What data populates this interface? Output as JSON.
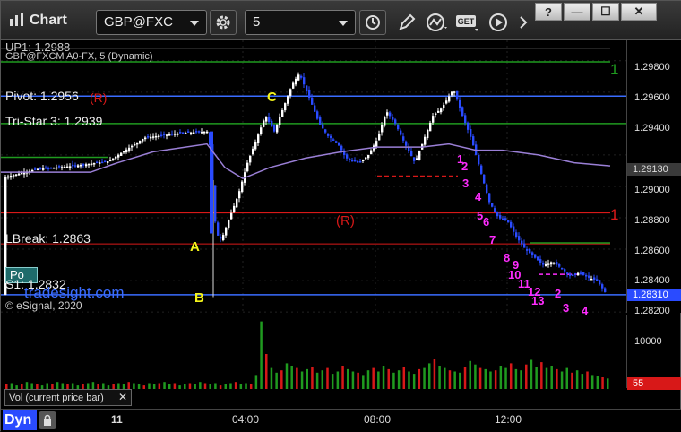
{
  "app": {
    "title": "Chart",
    "symbol": "GBP@FXC",
    "interval": "5",
    "window_buttons": [
      "?",
      "—",
      "☐",
      "✕"
    ]
  },
  "study": {
    "series_label": "GBP@FXCM A0-FX, 5 (Dynamic)",
    "top_cut_label": "UP1: 1.2988",
    "watermark": "tradesight.com",
    "copyright": "© eSignal, 2020",
    "button_label": "Po"
  },
  "levels": {
    "pivot": "Pivot: 1.2956",
    "pivot_tag": "(R)",
    "tristar": "Tri-Star 3: 1.2939",
    "lbreak": "LBreak: 1.2863",
    "s1": "S1: 1.2832",
    "r_tag": "(R)",
    "right_marks": [
      "1",
      "1"
    ]
  },
  "markers": {
    "A": "A",
    "B": "B",
    "C": "C"
  },
  "y_axis": {
    "labels": [
      "1.29800",
      "1.29600",
      "1.29400",
      "1.29130",
      "1.29000",
      "1.28800",
      "1.28600",
      "1.28400",
      "1.28310",
      "1.28200"
    ],
    "current_price": "1.28310",
    "ma_price": "1.29130"
  },
  "volume": {
    "label": "Vol (current price bar)",
    "scale_label": "10000",
    "current": "55",
    "values": [
      4,
      5,
      3,
      4,
      6,
      5,
      4,
      3,
      5,
      4,
      6,
      5,
      4,
      5,
      3,
      4,
      5,
      6,
      4,
      5,
      3,
      4,
      5,
      4,
      6,
      5,
      4,
      3,
      5,
      4,
      5,
      6,
      4,
      5,
      3,
      4,
      5,
      4,
      6,
      5,
      4,
      5,
      3,
      4,
      5,
      6,
      4,
      5,
      4,
      12,
      58,
      30,
      18,
      14,
      16,
      22,
      20,
      18,
      15,
      17,
      19,
      14,
      16,
      18,
      13,
      15,
      20,
      17,
      15,
      14,
      12,
      16,
      18,
      15,
      20,
      17,
      14,
      16,
      19,
      15,
      13,
      17,
      18,
      22,
      26,
      20,
      18,
      16,
      15,
      14,
      19,
      24,
      21,
      18,
      17,
      15,
      16,
      20,
      18,
      22,
      17,
      16,
      21,
      25,
      19,
      23,
      18,
      20,
      17,
      15,
      18,
      14,
      16,
      13,
      15,
      12,
      11,
      10,
      9
    ]
  },
  "time_axis": {
    "labels": [
      "11",
      "04:00",
      "08:00",
      "12:00"
    ],
    "dyn": "Dyn"
  },
  "tdseq": {
    "magenta": [
      "1",
      "2",
      "3",
      "4",
      "5",
      "6",
      "7",
      "8",
      "9",
      "10",
      "11",
      "12",
      "13",
      "2",
      "3",
      "4"
    ]
  },
  "colors": {
    "up_candle": "#ffffff",
    "down_candle": "#2a4bff",
    "ma": "#9a7fd6",
    "green_level": "#1f9a1f",
    "red_level": "#d81818",
    "blue_level": "#3a6cff",
    "magenta": "#ff2cff",
    "yellow": "#f5f51a"
  }
}
